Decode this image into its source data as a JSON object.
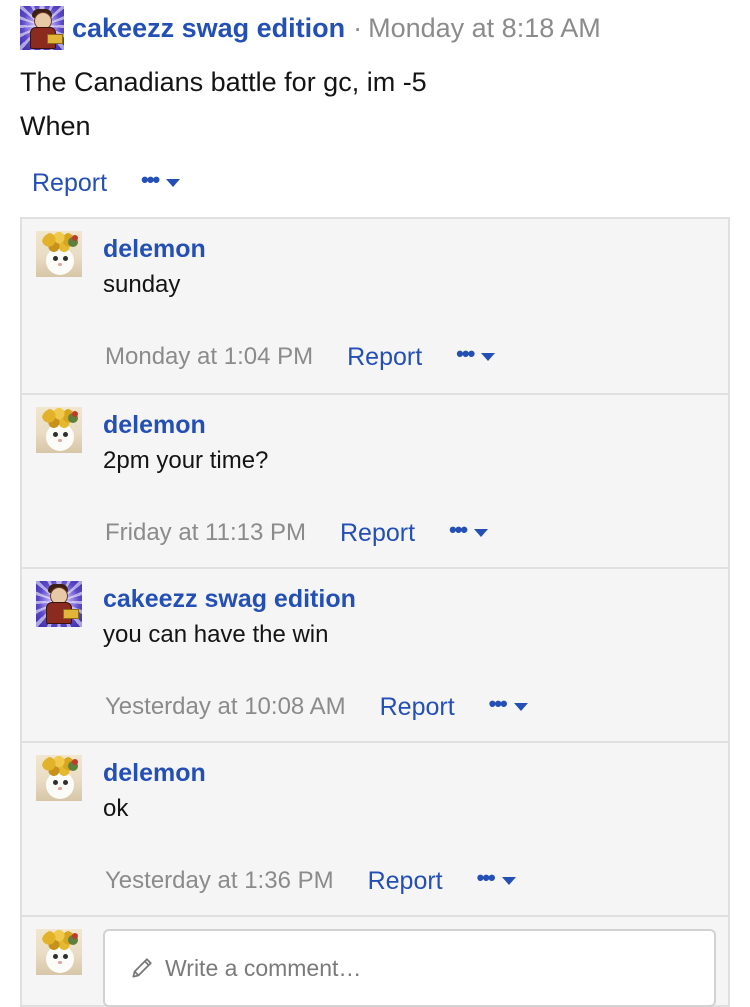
{
  "post": {
    "author": "cakeezz swag edition",
    "separator": "·",
    "timestamp": "Monday at 8:18 AM",
    "text_line1": "The Canadians battle for gc, im -5",
    "text_line2": "When",
    "report_label": "Report",
    "more_label": "•••"
  },
  "comments": [
    {
      "author": "delemon",
      "text": "sunday",
      "timestamp": "Monday at 1:04 PM",
      "report_label": "Report",
      "more_label": "•••"
    },
    {
      "author": "delemon",
      "text": "2pm your time?",
      "timestamp": "Friday at 11:13 PM",
      "report_label": "Report",
      "more_label": "•••"
    },
    {
      "author": "cakeezz swag edition",
      "text": "you can have the win",
      "timestamp": "Yesterday at 10:08 AM",
      "report_label": "Report",
      "more_label": "•••"
    },
    {
      "author": "delemon",
      "text": "ok",
      "timestamp": "Yesterday at 1:36 PM",
      "report_label": "Report",
      "more_label": "•••"
    }
  ],
  "new_comment": {
    "placeholder": "Write a comment…"
  },
  "icons": {
    "more": "ellipsis-icon",
    "caret": "caret-down-icon",
    "pencil": "pencil-icon"
  },
  "colors": {
    "link": "#2450b5",
    "muted": "#8b8b8b",
    "text": "#141414",
    "panel": "#f5f5f5",
    "border": "#e0e0e0"
  }
}
